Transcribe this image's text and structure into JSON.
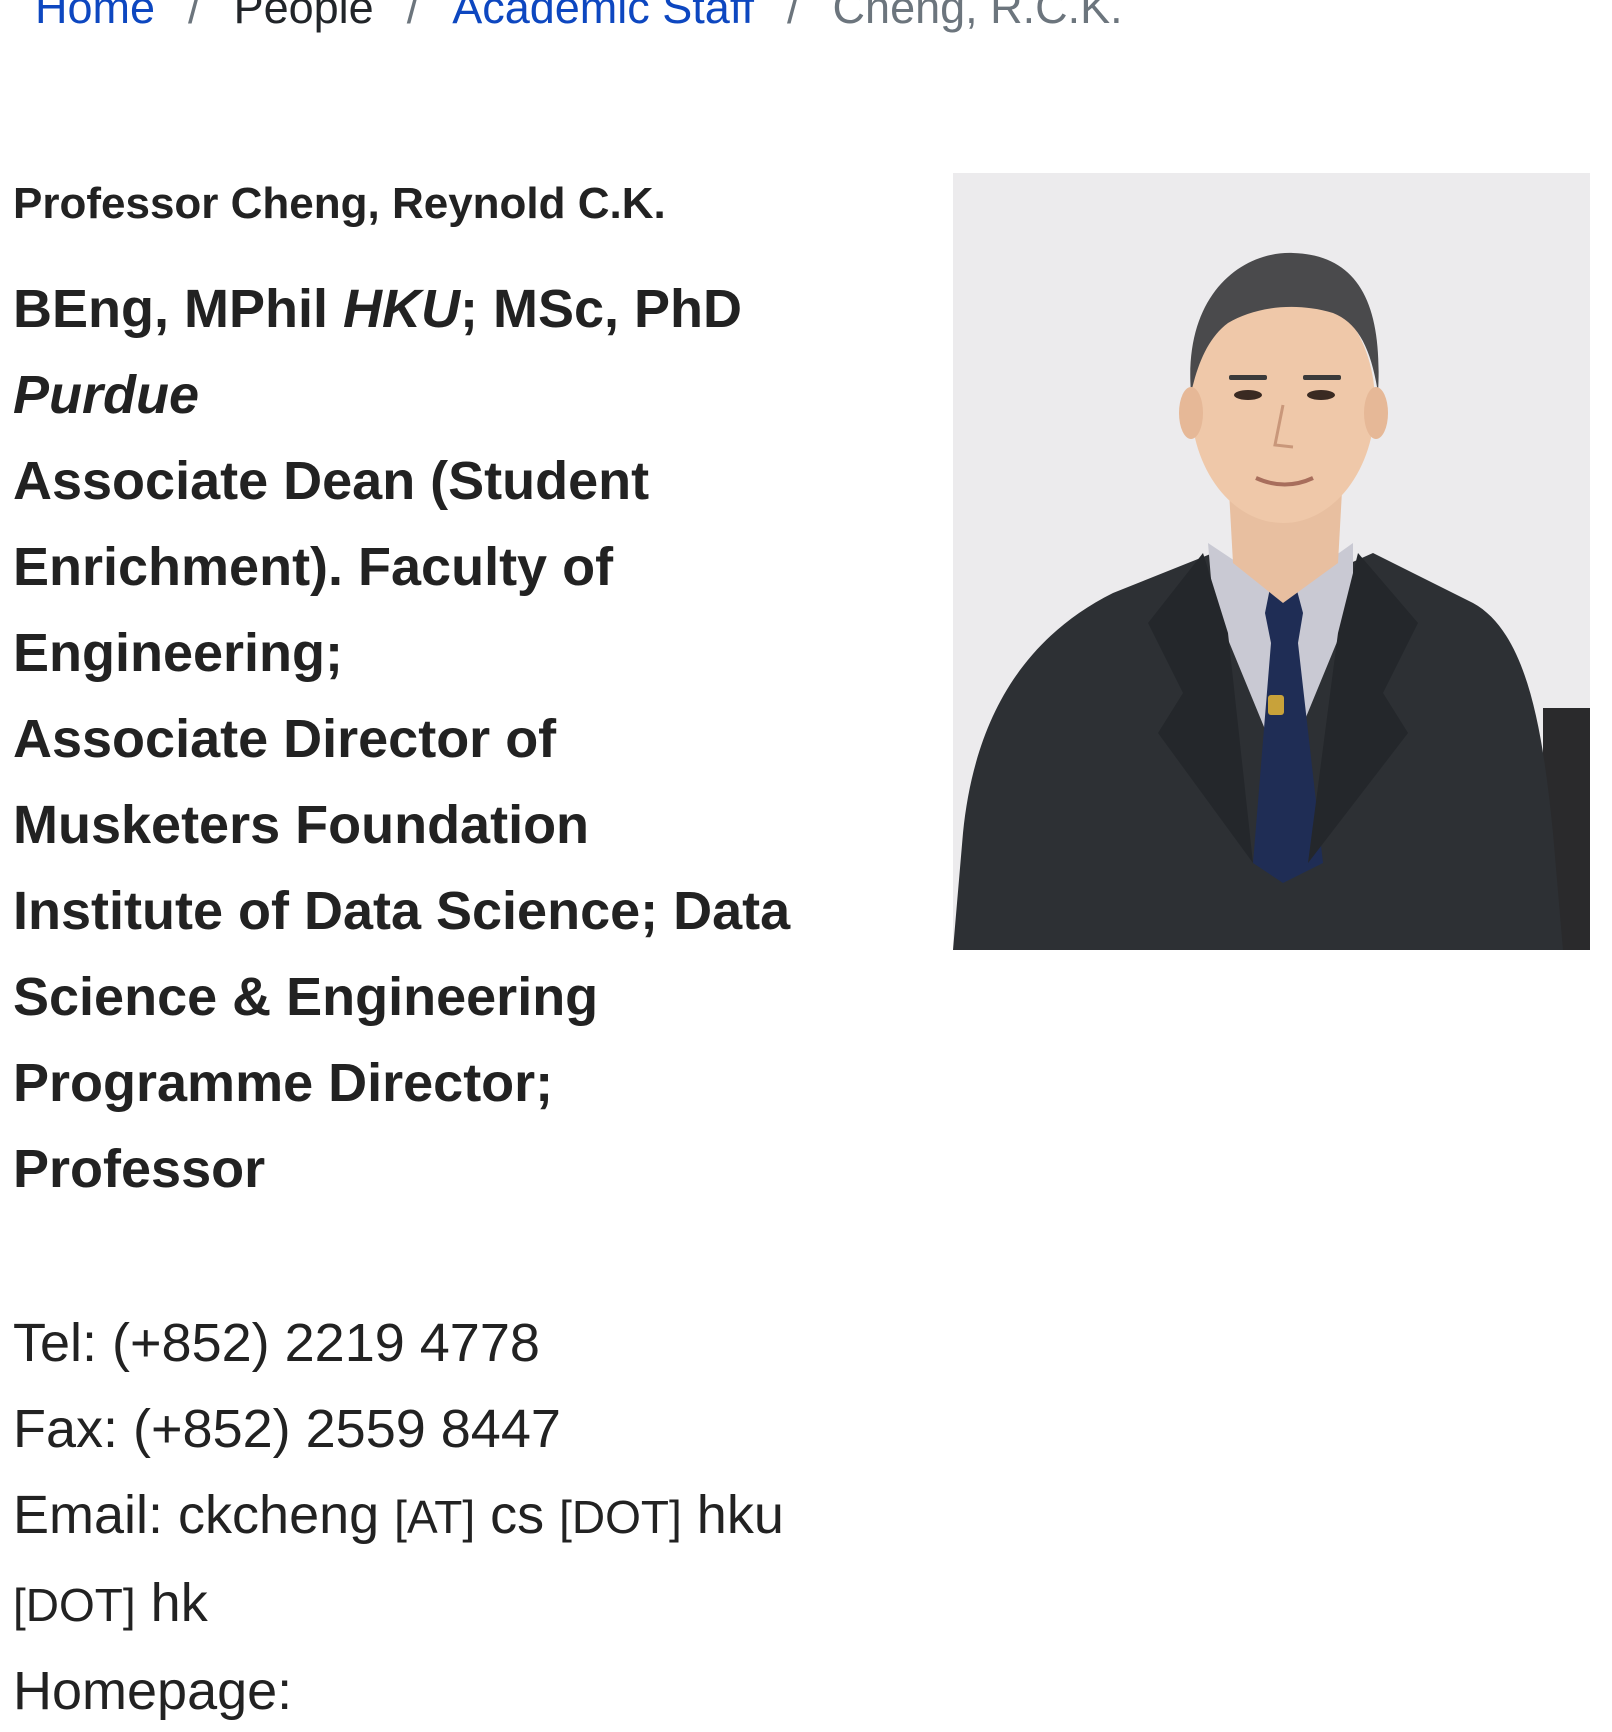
{
  "breadcrumb": {
    "home": "Home",
    "people": "People",
    "academic_staff": "Academic Staff",
    "current": "Cheng, R.C.K.",
    "separator": "/"
  },
  "profile": {
    "name": "Professor Cheng, Reynold C.K.",
    "qualifications": {
      "part1": "BEng, MPhil ",
      "hku": "HKU",
      "part2": "; MSc, PhD",
      "purdue": "Purdue"
    },
    "titles": [
      "Associate Dean (Student",
      "Enrichment). Faculty of",
      "Engineering;",
      "Associate Director of",
      "Musketers Foundation",
      "Institute of Data Science; Data",
      "Science & Engineering",
      "Programme Director;",
      "Professor"
    ]
  },
  "contact": {
    "tel": "Tel: (+852) 2219 4778",
    "fax": "Fax: (+852) 2559 8447",
    "email_prefix": "Email: ckcheng ",
    "at": "[AT]",
    "email_mid1": " cs ",
    "dot1": "[DOT]",
    "email_mid2": " hku",
    "dot2": "[DOT]",
    "email_end": " hk",
    "homepage": "Homepage:"
  },
  "colors": {
    "link": "#0d47c0",
    "muted": "#6c757d",
    "text": "#222222",
    "photo_background": "#ecebed"
  }
}
